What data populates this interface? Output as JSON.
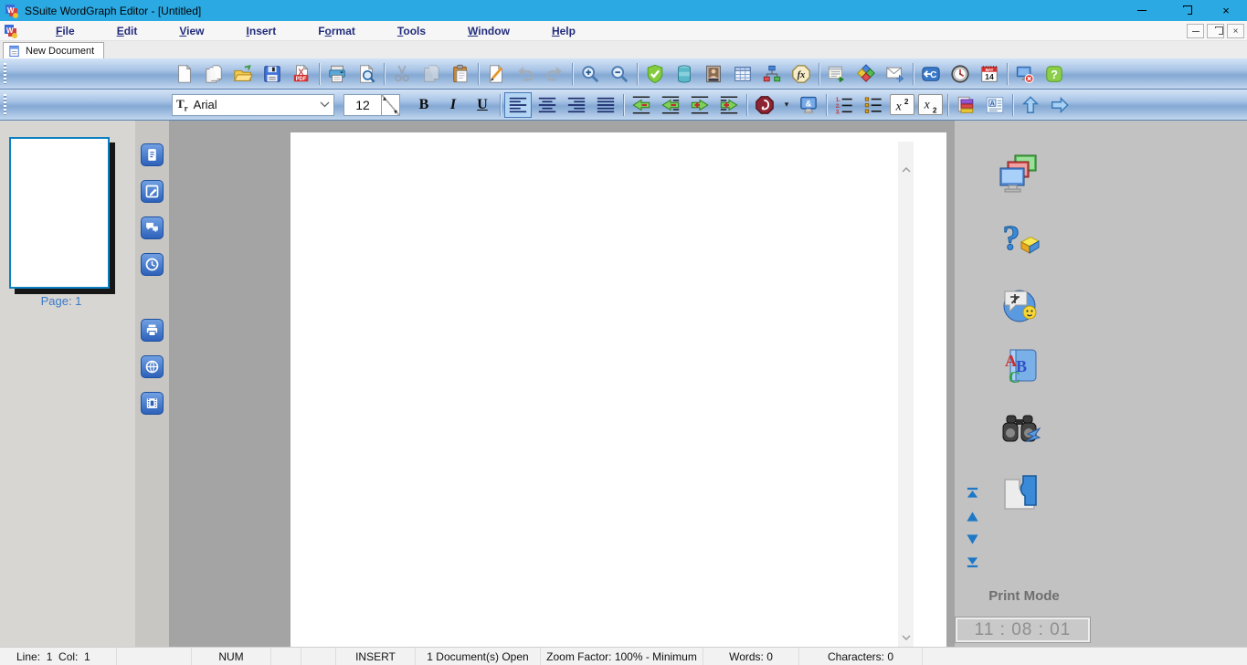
{
  "window": {
    "title": "SSuite WordGraph Editor - [Untitled]",
    "controls": [
      "minimize",
      "restore",
      "close"
    ],
    "mdi_controls": [
      "minimize",
      "restore",
      "close"
    ]
  },
  "menu": {
    "items": [
      {
        "label": "File",
        "accel": 0
      },
      {
        "label": "Edit",
        "accel": 0
      },
      {
        "label": "View",
        "accel": 0
      },
      {
        "label": "Insert",
        "accel": 0
      },
      {
        "label": "Format",
        "accel": 1
      },
      {
        "label": "Tools",
        "accel": 0
      },
      {
        "label": "Window",
        "accel": 0
      },
      {
        "label": "Help",
        "accel": 0
      }
    ]
  },
  "tab": {
    "label": "New Document"
  },
  "toolbar_main": {
    "items": [
      {
        "type": "button",
        "icon": "new-document-icon",
        "name": "new-document-button"
      },
      {
        "type": "button",
        "icon": "document-copies-icon",
        "name": "document-copies-button"
      },
      {
        "type": "button",
        "icon": "open-folder-icon",
        "name": "open-button"
      },
      {
        "type": "button",
        "icon": "save-icon",
        "name": "save-button"
      },
      {
        "type": "button",
        "icon": "export-pdf-icon",
        "name": "export-pdf-button"
      },
      {
        "type": "sep"
      },
      {
        "type": "button",
        "icon": "print-icon",
        "name": "print-button"
      },
      {
        "type": "button",
        "icon": "print-preview-icon",
        "name": "print-preview-button"
      },
      {
        "type": "sep"
      },
      {
        "type": "button",
        "icon": "cut-icon",
        "name": "cut-button",
        "disabled": true
      },
      {
        "type": "button",
        "icon": "copy-icon",
        "name": "copy-button",
        "disabled": true
      },
      {
        "type": "button",
        "icon": "paste-icon",
        "name": "paste-button"
      },
      {
        "type": "sep"
      },
      {
        "type": "button",
        "icon": "edit-pen-icon",
        "name": "edit-button"
      },
      {
        "type": "button",
        "icon": "undo-icon",
        "name": "undo-button",
        "disabled": true
      },
      {
        "type": "button",
        "icon": "redo-icon",
        "name": "redo-button",
        "disabled": true
      },
      {
        "type": "sep"
      },
      {
        "type": "button",
        "icon": "zoom-in-icon",
        "name": "zoom-in-button"
      },
      {
        "type": "button",
        "icon": "zoom-out-icon",
        "name": "zoom-out-button"
      },
      {
        "type": "sep"
      },
      {
        "type": "button",
        "icon": "spell-shield-icon",
        "name": "spell-check-button"
      },
      {
        "type": "button",
        "icon": "database-icon",
        "name": "database-button"
      },
      {
        "type": "button",
        "icon": "insert-image-icon",
        "name": "insert-image-button"
      },
      {
        "type": "button",
        "icon": "insert-table-icon",
        "name": "insert-table-button"
      },
      {
        "type": "button",
        "icon": "org-chart-icon",
        "name": "org-chart-button"
      },
      {
        "type": "button",
        "icon": "function-fx-icon",
        "name": "insert-function-button"
      },
      {
        "type": "sep"
      },
      {
        "type": "button",
        "icon": "insert-note-icon",
        "name": "insert-note-button"
      },
      {
        "type": "button",
        "icon": "shapes-icon",
        "name": "insert-shapes-button"
      },
      {
        "type": "button",
        "icon": "send-email-icon",
        "name": "send-email-button"
      },
      {
        "type": "sep"
      },
      {
        "type": "button",
        "icon": "go-to-icon",
        "name": "go-to-button"
      },
      {
        "type": "button",
        "icon": "insert-time-icon",
        "name": "insert-time-button"
      },
      {
        "type": "button",
        "icon": "insert-date-icon",
        "name": "insert-date-button"
      },
      {
        "type": "sep"
      },
      {
        "type": "button",
        "icon": "close-document-icon",
        "name": "close-document-button"
      },
      {
        "type": "button",
        "icon": "help-icon",
        "name": "help-button"
      }
    ]
  },
  "toolbar_format": {
    "font_name": "Arial",
    "font_size": "12",
    "items": [
      {
        "type": "fontcombo",
        "name": "font-family-combo"
      },
      {
        "type": "sizebox",
        "name": "font-size-input"
      },
      {
        "type": "textbtn",
        "label": "B",
        "style": "st-bold",
        "name": "bold-button"
      },
      {
        "type": "textbtn",
        "label": "I",
        "style": "st-italic",
        "name": "italic-button"
      },
      {
        "type": "textbtn",
        "label": "U",
        "style": "st-underline",
        "name": "underline-button"
      },
      {
        "type": "sep"
      },
      {
        "type": "button",
        "icon": "align-left-icon",
        "name": "align-left-button",
        "active": true
      },
      {
        "type": "button",
        "icon": "align-center-icon",
        "name": "align-center-button"
      },
      {
        "type": "button",
        "icon": "align-right-icon",
        "name": "align-right-button"
      },
      {
        "type": "button",
        "icon": "align-justify-icon",
        "name": "align-justify-button"
      },
      {
        "type": "sep"
      },
      {
        "type": "button",
        "icon": "outdent-icon",
        "name": "decrease-indent-button"
      },
      {
        "type": "button",
        "icon": "outdent-para-icon",
        "name": "decrease-indent-paragraph-button"
      },
      {
        "type": "button",
        "icon": "indent-icon",
        "name": "increase-indent-button"
      },
      {
        "type": "button",
        "icon": "indent-para-icon",
        "name": "increase-indent-paragraph-button"
      },
      {
        "type": "sep"
      },
      {
        "type": "button",
        "icon": "font-color-icon",
        "name": "font-color-button"
      },
      {
        "type": "caret",
        "name": "font-color-caret"
      },
      {
        "type": "button",
        "icon": "special-char-icon",
        "name": "special-characters-button"
      },
      {
        "type": "sep"
      },
      {
        "type": "button",
        "icon": "numbered-list-icon",
        "name": "numbered-list-button"
      },
      {
        "type": "button",
        "icon": "bullet-list-icon",
        "name": "bullet-list-button"
      },
      {
        "type": "button",
        "icon": "superscript-icon",
        "name": "superscript-button",
        "frame": true
      },
      {
        "type": "button",
        "icon": "subscript-icon",
        "name": "subscript-button",
        "frame": true
      },
      {
        "type": "sep"
      },
      {
        "type": "button",
        "icon": "highlight-layers-icon",
        "name": "highlight-button"
      },
      {
        "type": "button",
        "icon": "paragraph-format-icon",
        "name": "paragraph-format-button"
      },
      {
        "type": "sep"
      },
      {
        "type": "button",
        "icon": "arrow-up-icon",
        "name": "page-up-button"
      },
      {
        "type": "button",
        "icon": "arrow-right-icon",
        "name": "page-next-button"
      }
    ]
  },
  "left_panel": {
    "page_label": "Page: 1"
  },
  "left_strip": {
    "items": [
      {
        "icon": "strip-document-icon",
        "name": "panel-document-button"
      },
      {
        "icon": "strip-edit-icon",
        "name": "panel-edit-button"
      },
      {
        "icon": "strip-comments-icon",
        "name": "panel-comments-button"
      },
      {
        "icon": "strip-clock-icon",
        "name": "panel-history-button"
      },
      {
        "icon": "strip-print-icon",
        "name": "panel-print-button"
      },
      {
        "icon": "strip-globe-icon",
        "name": "panel-web-button"
      },
      {
        "icon": "strip-film-icon",
        "name": "panel-media-button"
      }
    ]
  },
  "right_panel": {
    "print_mode_label": "Print Mode",
    "clock_time": "11 : 08 : 01",
    "icons": [
      {
        "icon": "screens-icon",
        "name": "switch-screens-button"
      },
      {
        "icon": "help-about-icon",
        "name": "help-about-button"
      },
      {
        "icon": "translate-icon",
        "name": "translate-button"
      },
      {
        "icon": "spelling-icon",
        "name": "spelling-button"
      },
      {
        "icon": "find-icon",
        "name": "find-button"
      },
      {
        "icon": "plugin-icon",
        "name": "plugin-button"
      }
    ],
    "nav_arrows": [
      {
        "icon": "scroll-top-icon",
        "name": "scroll-top-button"
      },
      {
        "icon": "scroll-up-icon",
        "name": "scroll-up-button"
      },
      {
        "icon": "scroll-down-icon",
        "name": "scroll-down-button"
      },
      {
        "icon": "scroll-bottom-icon",
        "name": "scroll-bottom-button"
      }
    ]
  },
  "statusbar": {
    "cells": [
      "Line:  1  Col:  1",
      "",
      "NUM",
      "",
      "",
      "INSERT",
      "1 Document(s) Open",
      "Zoom Factor: 100% - Minimum",
      "Words: 0",
      "Characters: 0",
      ""
    ]
  },
  "colors": {
    "titlebar": "#2ba9e2",
    "toolbar_blue": "#84a9d4",
    "workspace_gray": "#a4a4a4",
    "page_label_blue": "#3a7bc8",
    "print_mode_gray": "#6f6f6f",
    "clock_digits_gray": "#8f8f8f",
    "menu_text_navy": "#232d7c"
  }
}
